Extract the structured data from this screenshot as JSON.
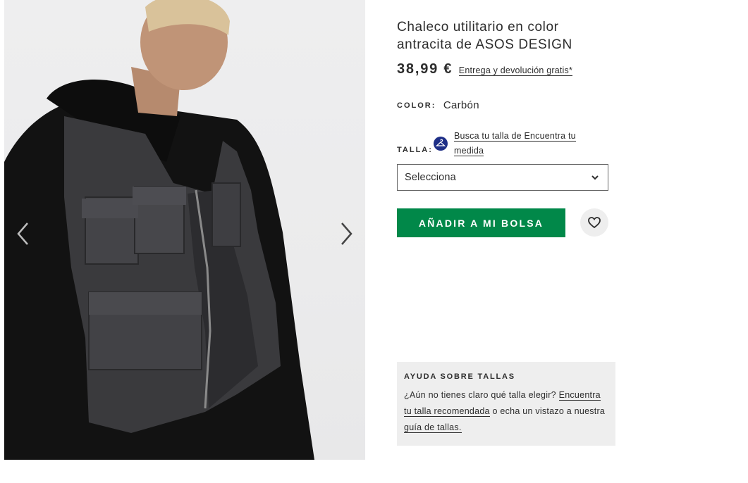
{
  "product": {
    "title": "Chaleco utilitario en color antracita de ASOS DESIGN",
    "price": "38,99 €",
    "delivery_link": "Entrega y devolución gratis*"
  },
  "color": {
    "label": "COLOR:",
    "value": "Carbón"
  },
  "size": {
    "label": "TALLA:",
    "fit_link": "Busca tu talla de Encuentra tu medida",
    "select_value": "Selecciona"
  },
  "actions": {
    "add_to_bag": "AÑADIR A MI BOLSA"
  },
  "help": {
    "title": "AYUDA SOBRE TALLAS",
    "text_before": "¿Aún no tienes claro qué talla elegir?",
    "link1": "Encuentra tu talla recomendada",
    "text_middle": "o echa un vistazo a nuestra",
    "link2": "guía de tallas."
  },
  "colors": {
    "accent_green": "#018849",
    "fit_icon_blue": "#1e2f87",
    "text": "#2d2d2d",
    "help_bg": "#eeeeee"
  },
  "icons": {
    "prev": "chevron-left-icon",
    "next": "chevron-right-icon",
    "fit": "hanger-icon",
    "dropdown": "chevron-down-icon",
    "save": "heart-icon"
  }
}
